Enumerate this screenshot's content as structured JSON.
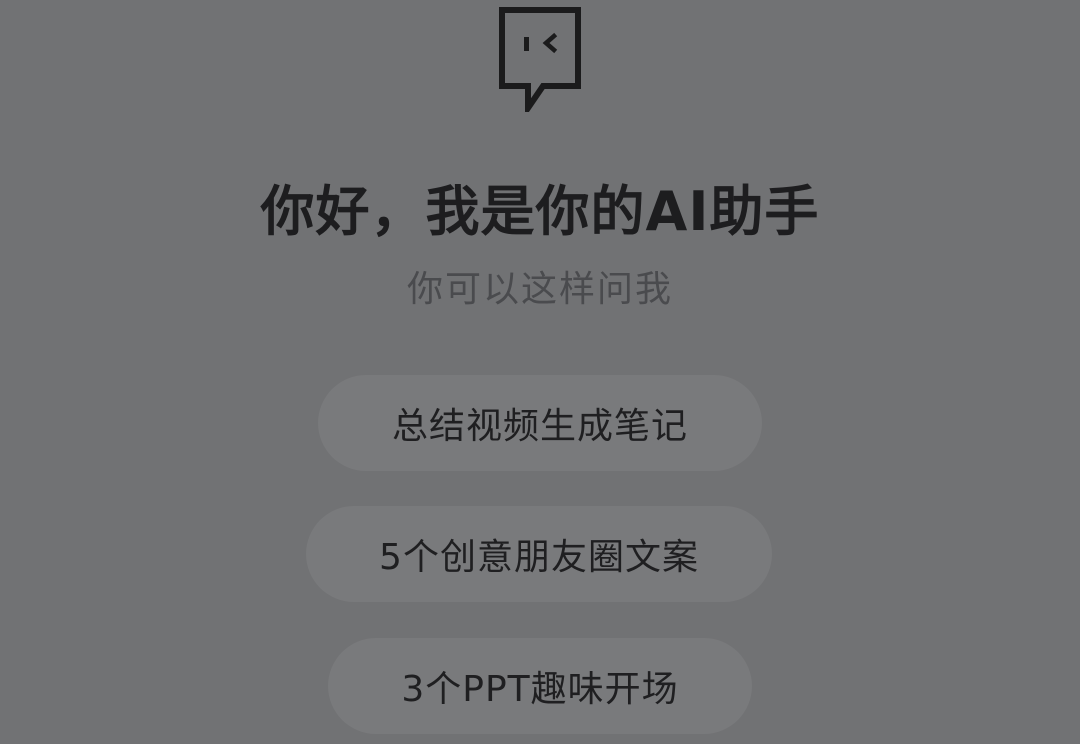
{
  "logo": {
    "icon": "chat-bubble-face-icon"
  },
  "greeting": {
    "title": "你好，我是你的AI助手",
    "subtitle": "你可以这样问我"
  },
  "suggestions": [
    {
      "label": "总结视频生成笔记"
    },
    {
      "label": "5个创意朋友圈文案"
    },
    {
      "label": "3个PPT趣味开场"
    }
  ]
}
